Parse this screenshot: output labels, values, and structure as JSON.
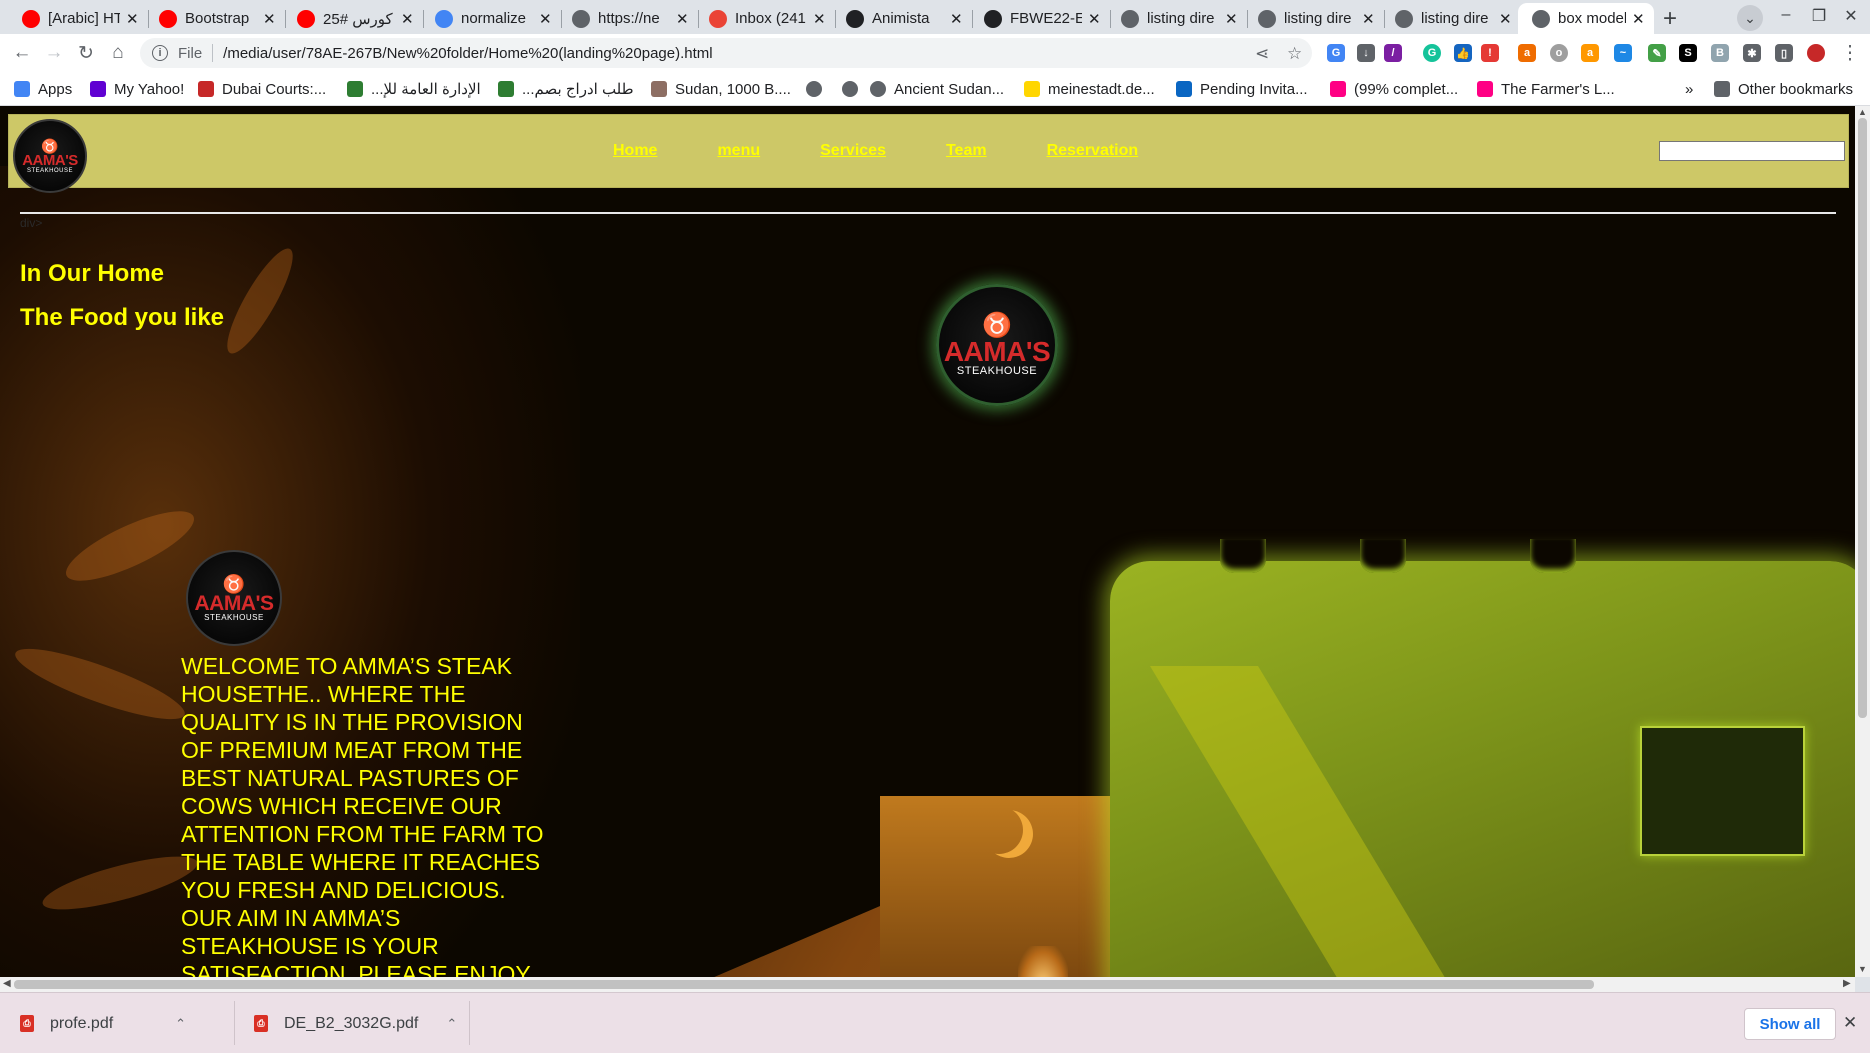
{
  "browser": {
    "tabs": [
      {
        "title": "[Arabic] HTML",
        "favicon": "youtube-icon",
        "color": "#ff0000"
      },
      {
        "title": "Bootstrap",
        "favicon": "youtube-icon",
        "color": "#ff0000"
      },
      {
        "title": "كورس #25",
        "favicon": "youtube-icon",
        "color": "#ff0000"
      },
      {
        "title": "normalize",
        "favicon": "google-icon",
        "color": "#4285f4"
      },
      {
        "title": "https://ne",
        "favicon": "globe-icon",
        "color": "#5f6368"
      },
      {
        "title": "Inbox (241",
        "favicon": "gmail-icon",
        "color": "#ea4335"
      },
      {
        "title": "Animista",
        "favicon": "animista-icon",
        "color": "#202124"
      },
      {
        "title": "FBWE22-E",
        "favicon": "github-icon",
        "color": "#202124"
      },
      {
        "title": "listing dire",
        "favicon": "globe-icon",
        "color": "#5f6368"
      },
      {
        "title": "listing dire",
        "favicon": "globe-icon",
        "color": "#5f6368"
      },
      {
        "title": "listing dire",
        "favicon": "globe-icon",
        "color": "#5f6368"
      },
      {
        "title": "box model",
        "favicon": "globe-icon",
        "color": "#5f6368",
        "active": true
      }
    ],
    "close_glyph": "✕",
    "new_tab_glyph": "+",
    "address": {
      "scheme": "File",
      "url": "/media/user/78AE-267B/New%20folder/Home%20(landing%20page).html"
    },
    "bookmarks": [
      {
        "label": "Apps",
        "icon": "apps-grid-icon",
        "color": "#4285f4"
      },
      {
        "label": "My Yahoo!",
        "icon": "yahoo-icon",
        "color": "#6001d2"
      },
      {
        "label": "Dubai Courts:...",
        "icon": "dubai-courts-icon",
        "color": "#c62828"
      },
      {
        "label": "...الإدارة العامة للإ",
        "icon": "emblem-icon",
        "color": "#2e7d32"
      },
      {
        "label": "...طلب ادراج بصم",
        "icon": "emblem-icon",
        "color": "#2e7d32"
      },
      {
        "label": "Sudan, 1000 B....",
        "icon": "folder-page-icon",
        "color": "#8d6e63"
      },
      {
        "label": "",
        "icon": "globe-icon",
        "color": "#5f6368"
      },
      {
        "label": "",
        "icon": "globe-icon",
        "color": "#5f6368"
      },
      {
        "label": "Ancient Sudan...",
        "icon": "globe-icon",
        "color": "#5f6368"
      },
      {
        "label": "meinestadt.de...",
        "icon": "meinestadt-icon",
        "color": "#ffd600"
      },
      {
        "label": "Pending Invita...",
        "icon": "linkedin-icon",
        "color": "#0a66c2"
      },
      {
        "label": "(99% complet...",
        "icon": "flickr-icon",
        "color": "#ff0084"
      },
      {
        "label": "The Farmer's L...",
        "icon": "flickr-icon",
        "color": "#ff0084"
      }
    ],
    "bookmarks_overflow": "»",
    "other_bookmarks": "Other bookmarks"
  },
  "site": {
    "logo": {
      "name": "AAMA'S",
      "sub": "STEAKHOUSE",
      "horns": "♉"
    },
    "nav": [
      "Home",
      "menu",
      "Services",
      "Team",
      "Reservation"
    ],
    "search_value": "",
    "tiny_label": "div>",
    "hero_line1": "In Our Home",
    "hero_line2": "The Food you like",
    "welcome_text": "Welcome to Amma’s steak housethe.. where the quality is in the provision of premium meat from the best natural pastures of cows which receive our attention from the farm to the table where it reaches you fresh and delicious. Our aim in Amma’s Steakhouse is your satisfaction. Please enjoy",
    "accent": "#ffff00",
    "header_bg": "#cdc867"
  },
  "downloads": {
    "items": [
      {
        "name": "profe.pdf"
      },
      {
        "name": "DE_B2_3032G.pdf"
      }
    ],
    "show_all": "Show all",
    "close": "✕"
  }
}
